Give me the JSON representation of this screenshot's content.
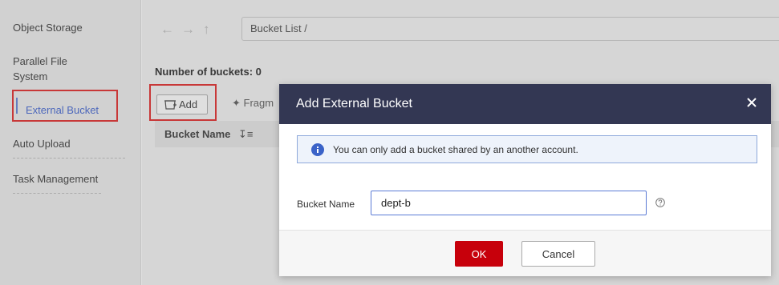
{
  "sidebar": {
    "items": [
      {
        "label": "Object Storage"
      },
      {
        "label": "Parallel File System"
      },
      {
        "label": "External Bucket"
      },
      {
        "label": "Auto Upload"
      },
      {
        "label": "Task Management"
      }
    ]
  },
  "nav": {
    "back_icon": "arrow-left-icon",
    "forward_icon": "arrow-right-icon",
    "up_icon": "arrow-up-icon",
    "breadcrumb": "Bucket List /"
  },
  "main": {
    "bucket_count": "Number of buckets: 0",
    "add_label": "Add",
    "fragment_label": "Fragm",
    "table": {
      "columns": [
        "Bucket Name"
      ]
    }
  },
  "dialog": {
    "title": "Add External Bucket",
    "info": "You can only add a bucket shared by an another account.",
    "field_label": "Bucket Name",
    "field_value": "dept-b",
    "ok_label": "OK",
    "cancel_label": "Cancel"
  },
  "colors": {
    "dialog_header": "#333753",
    "ok_button": "#c7000b",
    "highlight": "#e02020",
    "info_border": "#8ea9db"
  }
}
